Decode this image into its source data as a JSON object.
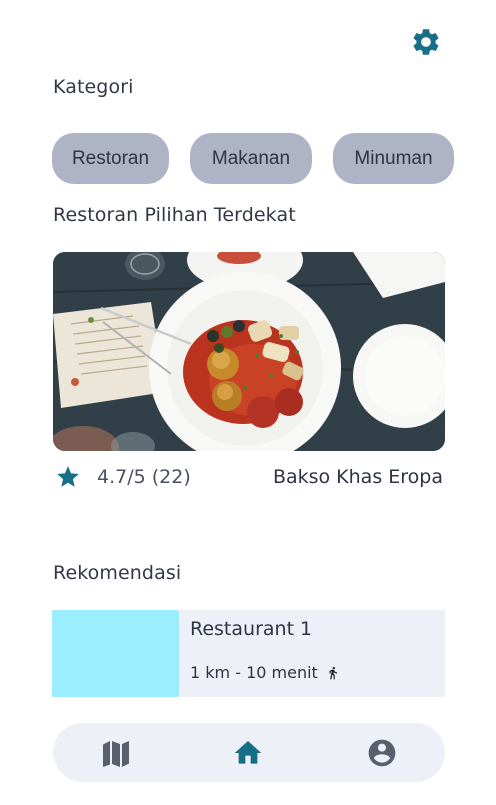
{
  "header": {
    "settings_icon": "gear-icon"
  },
  "categories": {
    "label": "Kategori",
    "chips": [
      {
        "label": "Restoran"
      },
      {
        "label": "Makanan"
      },
      {
        "label": "Minuman"
      }
    ]
  },
  "nearby": {
    "label": "Restoran Pilihan Terdekat",
    "featured": {
      "rating": "4.7/5 (22)",
      "name": "Bakso Khas Eropa",
      "rating_icon": "star-icon"
    }
  },
  "recommendations": {
    "label": "Rekomendasi",
    "items": [
      {
        "title": "Restaurant 1",
        "meta": "1 km - 10 menit",
        "icon": "walking-icon"
      }
    ]
  },
  "bottom_nav": {
    "items": [
      {
        "name": "map",
        "icon": "map-icon"
      },
      {
        "name": "home",
        "icon": "home-icon",
        "active": true
      },
      {
        "name": "profile",
        "icon": "account-icon"
      }
    ]
  },
  "colors": {
    "accent": "#166f86",
    "chip_bg": "#aeb3c6",
    "card_bg": "#eef0f8",
    "thumb_placeholder": "#9beeff",
    "nav_inactive": "#5a5f6e"
  }
}
